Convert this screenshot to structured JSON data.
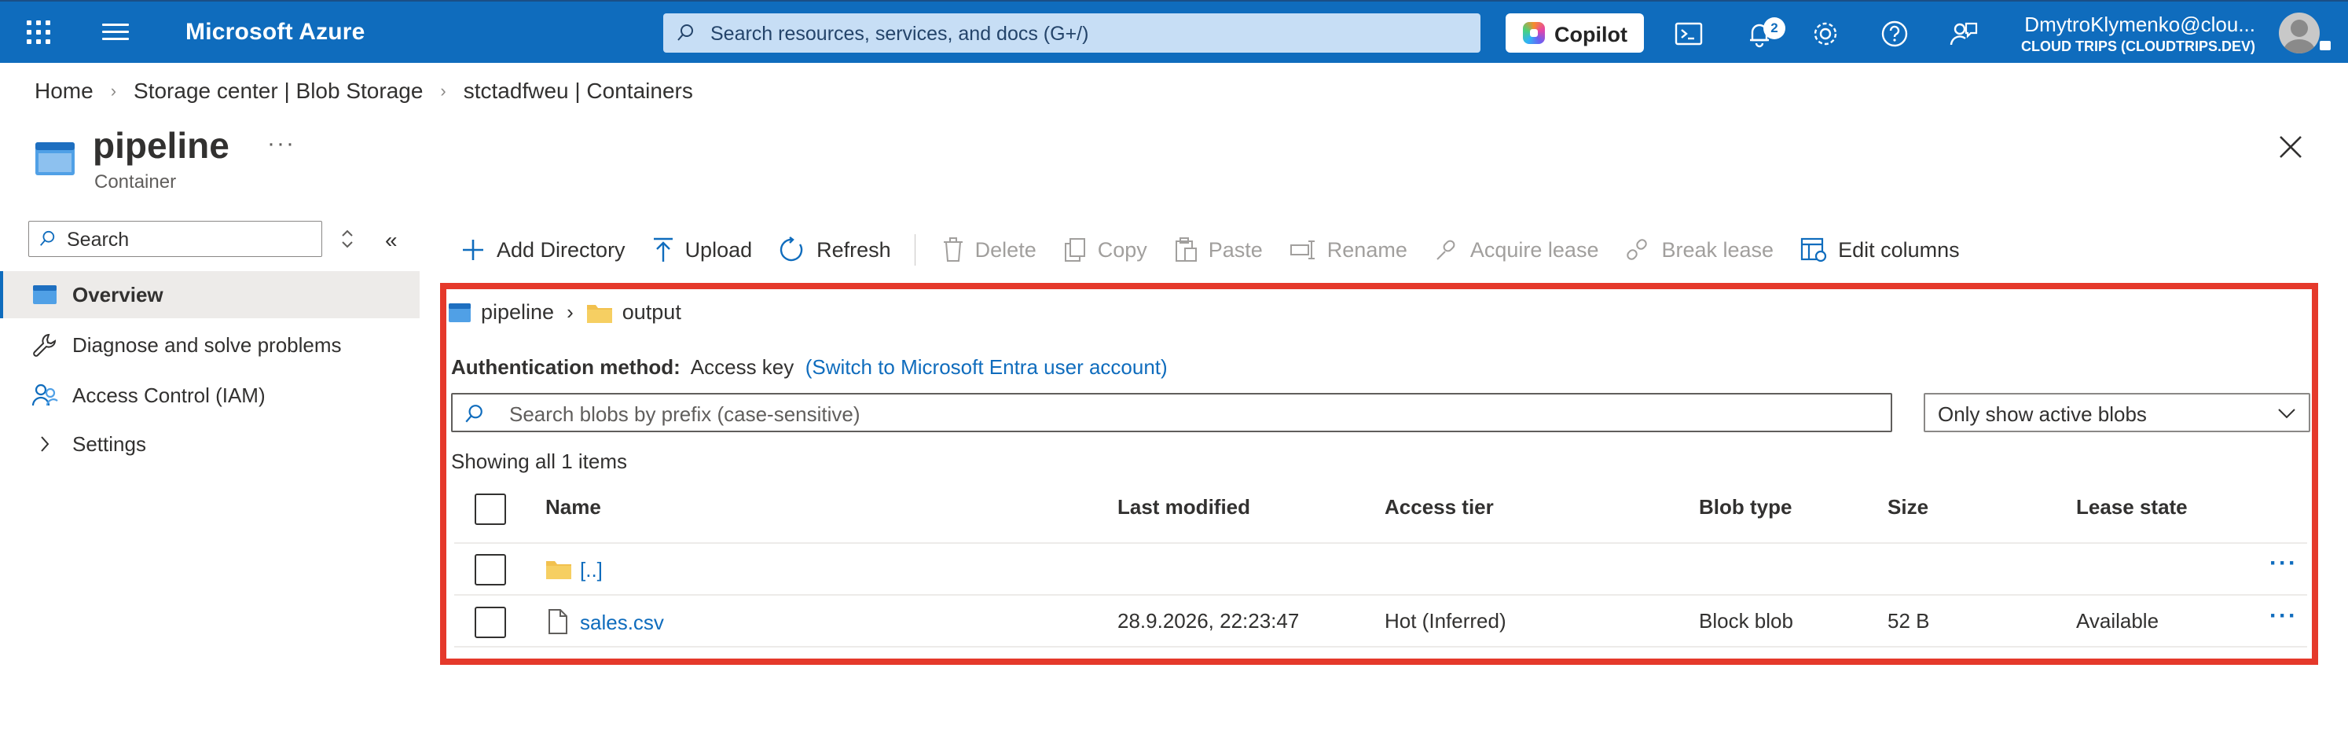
{
  "topbar": {
    "brand": "Microsoft Azure",
    "search_placeholder": "Search resources, services, and docs (G+/)",
    "copilot_label": "Copilot",
    "notifications_count": "2",
    "user_name": "DmytroKlymenko@clou...",
    "tenant": "CLOUD TRIPS (CLOUDTRIPS.DEV)"
  },
  "breadcrumb": [
    "Home",
    "Storage center | Blob Storage",
    "stctadfweu | Containers"
  ],
  "resource": {
    "title": "pipeline",
    "more": "···",
    "type": "Container"
  },
  "nav": {
    "search_placeholder": "Search",
    "items": [
      {
        "label": "Overview",
        "icon": "container-icon",
        "active": true
      },
      {
        "label": "Diagnose and solve problems",
        "icon": "wrench-icon"
      },
      {
        "label": "Access Control (IAM)",
        "icon": "people-icon"
      },
      {
        "label": "Settings",
        "icon": "chevron-right-icon"
      }
    ]
  },
  "commands": {
    "add_directory": "Add Directory",
    "upload": "Upload",
    "refresh": "Refresh",
    "delete": "Delete",
    "copy": "Copy",
    "paste": "Paste",
    "rename": "Rename",
    "acquire_lease": "Acquire lease",
    "break_lease": "Break lease",
    "edit_columns": "Edit columns"
  },
  "path": {
    "container": "pipeline",
    "folder": "output"
  },
  "auth": {
    "label": "Authentication method:",
    "value": "Access key",
    "switch_link": "(Switch to Microsoft Entra user account)"
  },
  "blob_search": {
    "placeholder": "Search blobs by prefix (case-sensitive)"
  },
  "filter": {
    "selected": "Only show active blobs"
  },
  "showing": "Showing all 1 items",
  "table": {
    "columns": {
      "name": "Name",
      "last_modified": "Last modified",
      "access_tier": "Access tier",
      "blob_type": "Blob type",
      "size": "Size",
      "lease_state": "Lease state"
    },
    "rows": [
      {
        "name": "[..]",
        "icon": "folder-icon",
        "last_modified": "",
        "access_tier": "",
        "blob_type": "",
        "size": "",
        "lease_state": ""
      },
      {
        "name": "sales.csv",
        "icon": "file-icon",
        "last_modified": "28.9.2026, 22:23:47",
        "access_tier": "Hot (Inferred)",
        "blob_type": "Block blob",
        "size": "52 B",
        "lease_state": "Available"
      }
    ],
    "row_more": "···"
  },
  "colors": {
    "brand_blue": "#0f6cbd",
    "highlight_red": "#e5392b",
    "folder_yellow": "#f2c14e"
  }
}
